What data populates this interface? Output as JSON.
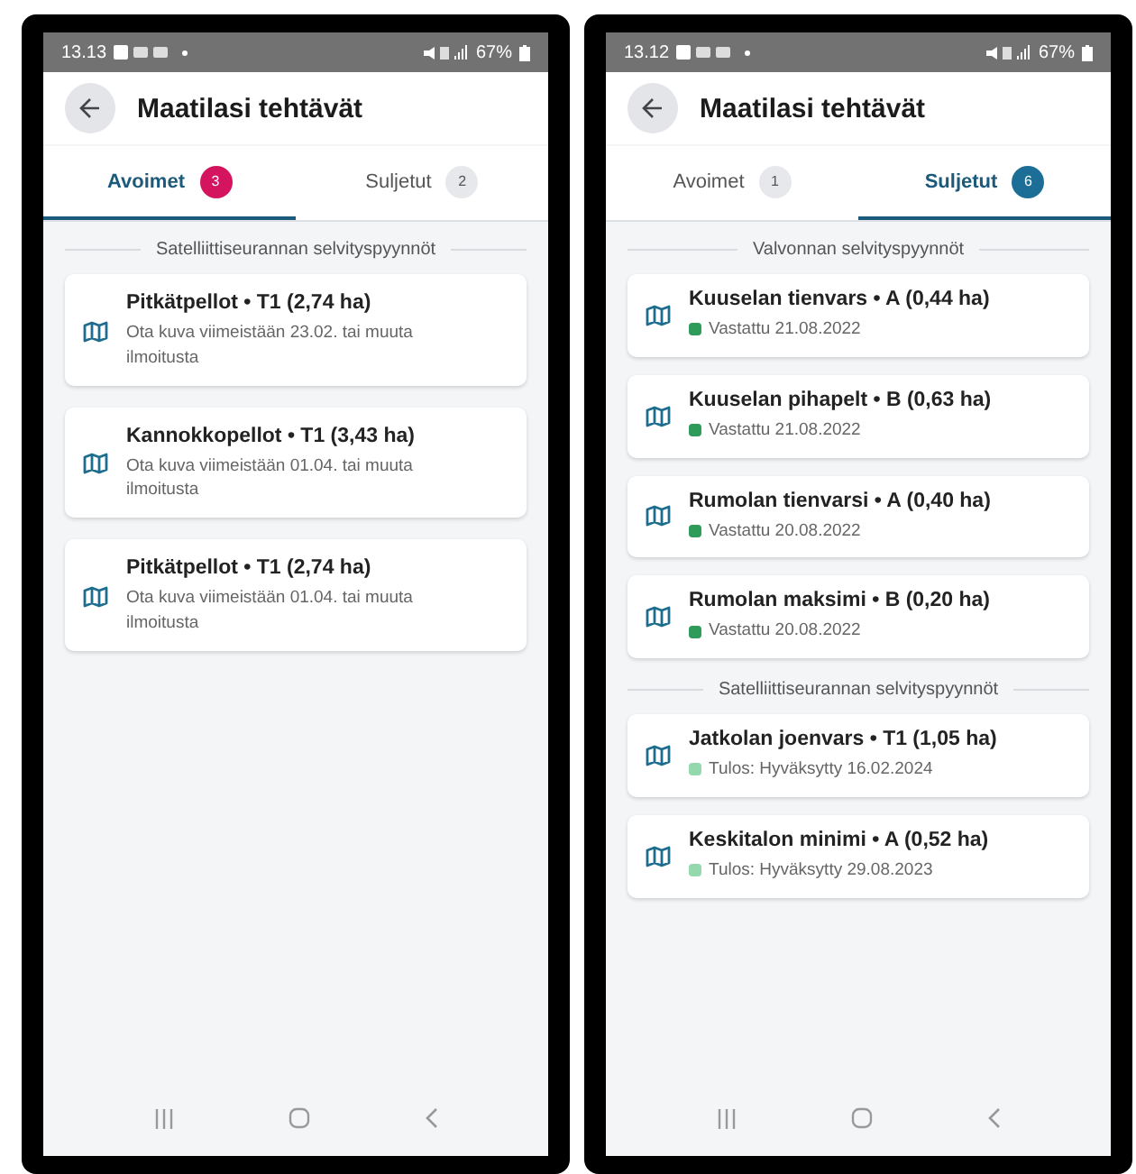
{
  "phones": [
    {
      "status_bar": {
        "time": "13.13",
        "battery": "67%"
      },
      "title": "Maatilasi tehtävät",
      "tabs": [
        {
          "label": "Avoimet",
          "count": "3",
          "selected": true,
          "color": "#d4145f"
        },
        {
          "label": "Suljetut",
          "count": "2",
          "selected": false
        }
      ],
      "sections": [
        {
          "heading": "Satelliittiseurannan selvityspyynnöt",
          "items": [
            {
              "kind": "note",
              "title": "Pitkätpellot • T1 (2,74 ha)",
              "subtitle": "Ota kuva viimeistään 23.02. tai muuta ilmoitusta"
            },
            {
              "kind": "note",
              "title": "Kannokkopellot • T1 (3,43 ha)",
              "subtitle": "Ota kuva viimeistään 01.04. tai muuta ilmoitusta"
            },
            {
              "kind": "note",
              "title": "Pitkätpellot • T1 (2,74 ha)",
              "subtitle": "Ota kuva viimeistään 01.04. tai muuta ilmoitusta"
            }
          ]
        }
      ]
    },
    {
      "status_bar": {
        "time": "13.12",
        "battery": "67%"
      },
      "title": "Maatilasi tehtävät",
      "tabs": [
        {
          "label": "Avoimet",
          "count": "1",
          "selected": false
        },
        {
          "label": "Suljetut",
          "count": "6",
          "selected": true,
          "color": "#1d6e96"
        }
      ],
      "sections": [
        {
          "heading": "Valvonnan selvityspyynnöt",
          "items": [
            {
              "kind": "status",
              "title": "Kuuselan tienvars • A (0,44 ha)",
              "subtitle": "Vastattu 21.08.2022",
              "color": "#2e9b5a"
            },
            {
              "kind": "status",
              "title": "Kuuselan pihapelt • B (0,63 ha)",
              "subtitle": "Vastattu 21.08.2022",
              "color": "#2e9b5a"
            },
            {
              "kind": "status",
              "title": "Rumolan tienvarsi • A (0,40 ha)",
              "subtitle": "Vastattu 20.08.2022",
              "color": "#2e9b5a"
            },
            {
              "kind": "status",
              "title": "Rumolan maksimi • B (0,20 ha)",
              "subtitle": "Vastattu 20.08.2022",
              "color": "#2e9b5a"
            }
          ]
        },
        {
          "heading": "Satelliittiseurannan selvityspyynnöt",
          "items": [
            {
              "kind": "status",
              "title": "Jatkolan joenvars • T1 (1,05 ha)",
              "subtitle": "Tulos: Hyväksytty 16.02.2024",
              "color": "#93d9ad"
            },
            {
              "kind": "status",
              "title": "Keskitalon minimi • A (0,52 ha)",
              "subtitle": "Tulos: Hyväksytty 29.08.2023",
              "color": "#93d9ad"
            }
          ]
        }
      ]
    }
  ]
}
